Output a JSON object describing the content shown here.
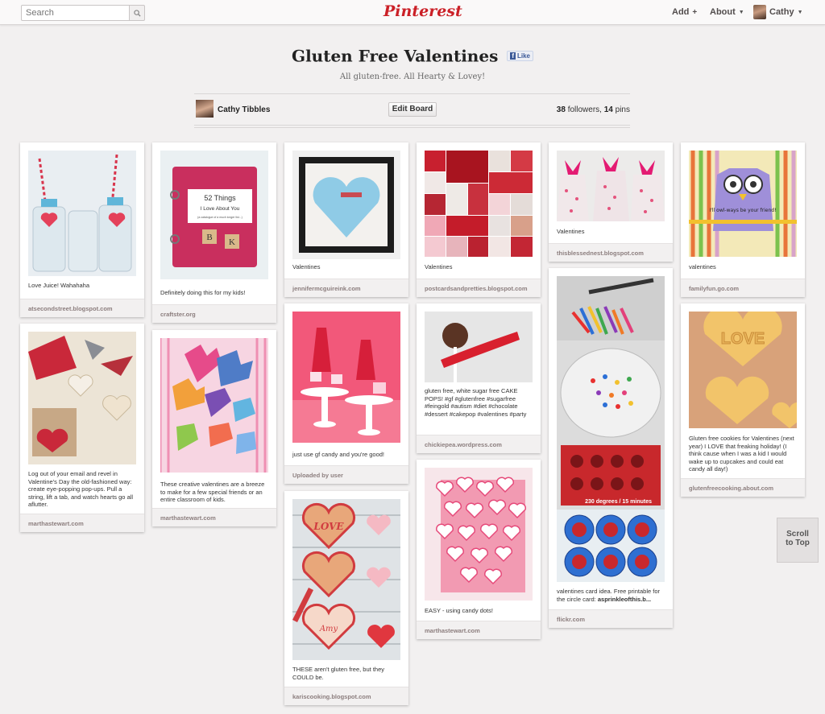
{
  "header": {
    "search_placeholder": "Search",
    "logo": "Pinterest",
    "nav_add": "Add",
    "nav_about": "About",
    "user_name": "Cathy"
  },
  "board": {
    "title": "Gluten Free Valentines",
    "fb_like": "Like",
    "description": "All gluten-free. All Hearty & Lovey!",
    "owner": "Cathy Tibbles",
    "edit_button": "Edit Board",
    "followers_count": "38",
    "followers_label": "followers,",
    "pins_count": "14",
    "pins_label": "pins"
  },
  "pins": [
    {
      "desc": "Love Juice! Wahahaha",
      "source": "atsecondstreet.blogspot.com"
    },
    {
      "desc": "Log out of your email and revel in Valentine's Day the old-fashioned way: create eye-popping pop-ups. Pull a string, lift a tab, and watch hearts go all aflutter.",
      "source": "marthastewart.com"
    },
    {
      "desc": "Definitely doing this for my kids!",
      "source": "craftster.org"
    },
    {
      "desc": "These creative valentines are a breeze to make for a few special friends or an entire classroom of kids.",
      "source": "marthastewart.com"
    },
    {
      "desc": "Valentines",
      "source": "jennifermcguireink.com"
    },
    {
      "desc": "just use gf candy and you're good!",
      "source": "Uploaded by user"
    },
    {
      "desc": "THESE aren't gluten free, but they COULD be.",
      "source": "kariscooking.blogspot.com"
    },
    {
      "desc": "Valentines",
      "source": "postcardsandpretties.blogspot.com"
    },
    {
      "desc": "gluten free, white sugar free CAKE POPS! #gf #glutenfree #sugarfree #feingold #autism #diet #chocolate #dessert #cakepop #valentines #party",
      "source": "chickiepea.wordpress.com"
    },
    {
      "desc": "EASY - using candy dots!",
      "source": "marthastewart.com"
    },
    {
      "desc": "Valentines",
      "source": "thisblessednest.blogspot.com"
    },
    {
      "desc_prefix": "valentines card idea. Free printable for the circle card:",
      "desc_link": "asprinkleofthis.b...",
      "source": "flickr.com"
    },
    {
      "desc": "valentines",
      "source": "familyfun.go.com"
    },
    {
      "desc": "Gluten free cookies for Valentines (next year) I LOVE that freaking holiday! (I think cause when I was a kid I would wake up to cupcakes and could eat candy all day!)",
      "source": "glutenfreecooking.about.com"
    }
  ],
  "image_text": {
    "book_line1": "52 Things",
    "book_line2": "I Love About You",
    "book_line3": "(a catalogue of a much longer list...)",
    "tile_b": "B",
    "tile_k": "K",
    "cookie_love": "LOVE",
    "cookie_amy": "Amy",
    "owl_text": "I'll owl-ways be your friend!",
    "crayon_caption": "230 degrees / 15 minutes",
    "shortbread_love": "LOVE"
  },
  "scroll_to_top": {
    "line1": "Scroll",
    "line2": "to Top"
  },
  "colors": {
    "brand": "#cb2027",
    "background": "#f2f0f0",
    "source_text": "#8c7e7e"
  }
}
